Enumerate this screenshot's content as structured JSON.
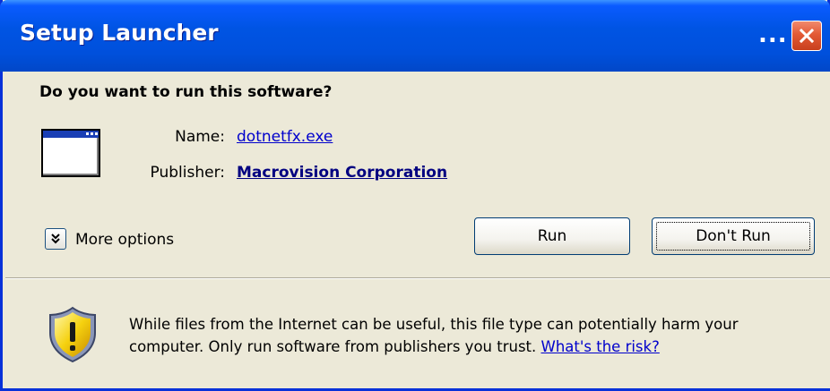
{
  "window": {
    "title": "Setup Launcher",
    "title_overflow": "...",
    "title_color": "#0054e3",
    "close_icon": "close-icon"
  },
  "dialog": {
    "question": "Do you want to run this software?",
    "app_icon": "application-window-icon",
    "name_label": "Name:",
    "name_value": "dotnetfx.exe",
    "publisher_label": "Publisher:",
    "publisher_value": "Macrovision Corporation",
    "more_options_label": "More options",
    "more_options_icon": "chevron-double-down-icon"
  },
  "buttons": {
    "run_label": "Run",
    "dont_run_label": "Don't Run"
  },
  "warning": {
    "icon": "shield-warning-icon",
    "text": "While files from the Internet can be useful, this file type can potentially harm your computer. Only run software from publishers you trust.",
    "risk_link": "What's the risk?",
    "link_color": "#0000cc"
  }
}
